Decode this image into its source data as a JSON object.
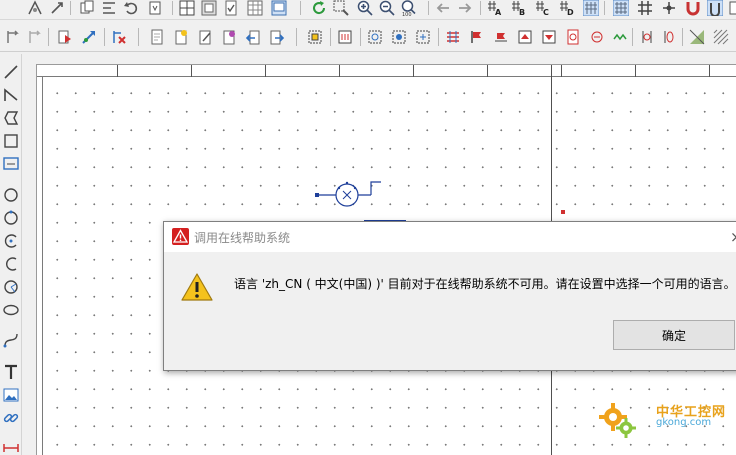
{
  "toolbar_top": {
    "icons": [
      "move-icon",
      "repeat-icon",
      "copy-icon",
      "align-icon",
      "undo-icon",
      "paste-icon",
      "grid-view-icon",
      "sheet-icon",
      "check-icon",
      "table-icon",
      "window-icon",
      "refresh-icon",
      "zoom-area-icon",
      "zoom-in-icon",
      "zoom-out-icon",
      "zoom-100-icon",
      "arrow-left-icon",
      "arrow-right-icon",
      "annotate-a-icon",
      "annotate-b-icon",
      "annotate-c-icon",
      "annotate-d-icon",
      "grid-toggle-icon",
      "grid-fine-icon",
      "grid-coarse-icon",
      "junction-icon",
      "magnet-icon",
      "highlight-icon"
    ]
  },
  "toolbar_second": {
    "icons": [
      "select-icon",
      "select-next-icon",
      "document-icon",
      "arrow-place-icon",
      "no-erc-icon",
      "page-icon",
      "new-page-icon",
      "page-edit-icon",
      "page-link-icon",
      "page-back-icon",
      "page-forward-icon",
      "hierarchy-icon",
      "component-icon",
      "part-a-icon",
      "part-b-icon",
      "part-c-icon",
      "bus-entry-icon",
      "flag-icon",
      "net-label-icon",
      "port-a-icon",
      "port-b-icon",
      "port-c-icon",
      "signal-icon",
      "pin-a-icon",
      "pin-b-icon",
      "fill-icon",
      "pattern-icon"
    ]
  },
  "left_tools": [
    "line-icon",
    "polyline-icon",
    "polygon-icon",
    "rectangle-icon",
    "text-box-icon",
    "circle-icon",
    "ellipse-icon",
    "arc-icon",
    "arc-alt-icon",
    "pie-icon",
    "oval-icon",
    "bezier-icon",
    "text-icon",
    "image-icon",
    "link-icon",
    "dimension-icon"
  ],
  "dialog": {
    "title": "调用在线帮助系统",
    "message": "语言 'zh_CN ( 中文(中国) )' 目前对于在线帮助系统不可用。请在设置中选择一个可用的语言。",
    "ok_label": "确定",
    "close_glyph": "×"
  },
  "watermark": {
    "line1": "中华工控网",
    "line2": "gkong.com"
  },
  "colors": {
    "accent_blue": "#1e5fb4",
    "warning_yellow": "#f4c21d",
    "error_red": "#d42020",
    "watermark_orange": "#e8a21c"
  }
}
